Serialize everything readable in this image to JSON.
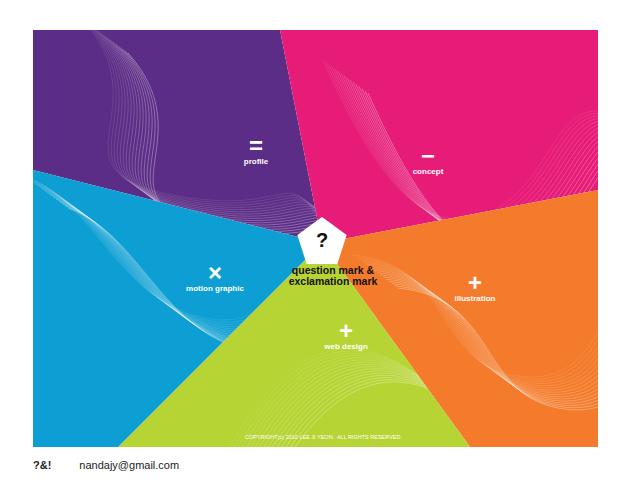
{
  "site": {
    "center": {
      "mark": "?",
      "title_lines": [
        "question mark &",
        "exclamation mark"
      ]
    },
    "sections": [
      {
        "label": "profile",
        "icon": "=",
        "color": "#5c2d86"
      },
      {
        "label": "concept",
        "icon": "−",
        "color": "#e61c78"
      },
      {
        "label": "illustration",
        "icon": "+",
        "color": "#f47b2b"
      },
      {
        "label": "web design",
        "icon": "+",
        "color": "#b6d433"
      },
      {
        "label": "motion graphic",
        "icon": "×",
        "color": "#0d9fd3"
      }
    ],
    "copyright": "COPYRIGHT(c) 2010 LEE JI YEON.  ALL RIGHTS RESERVED."
  },
  "footer": {
    "logo": "?&!",
    "email": "nandajy@gmail.com"
  }
}
